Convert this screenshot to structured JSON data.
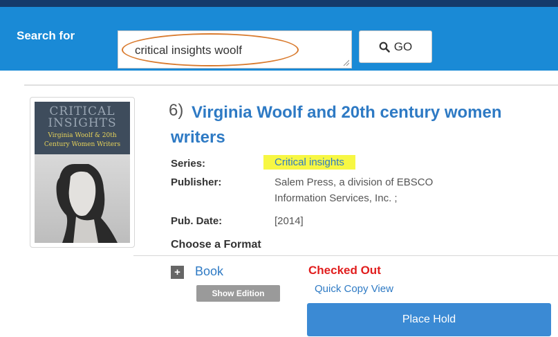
{
  "search": {
    "label": "Search for",
    "value": "critical insights woolf",
    "go_label": "GO"
  },
  "result": {
    "number": "6)",
    "title": "Virginia Woolf and 20th century women writers",
    "cover": {
      "title_line1": "CRITICAL",
      "title_line2": "INSIGHTS",
      "subtitle_line1": "Virginia Woolf & 20th",
      "subtitle_line2": "Century Women Writers"
    },
    "series_label": "Series:",
    "series_value": "Critical insights",
    "publisher_label": "Publisher:",
    "publisher_value_line1": "Salem Press, a division of EBSCO",
    "publisher_value_line2": "Information Services, Inc. ;",
    "pubdate_label": "Pub. Date:",
    "pubdate_value": "[2014]"
  },
  "format": {
    "heading": "Choose a Format",
    "expand_symbol": "+",
    "type": "Book",
    "show_edition": "Show Edition",
    "status": "Checked Out",
    "quick_copy": "Quick Copy View",
    "place_hold": "Place Hold"
  },
  "colors": {
    "header_blue": "#1a8ad6",
    "top_strip": "#153a6b",
    "link_blue": "#2e7ac4",
    "status_red": "#e11d1d",
    "highlight_yellow": "#f7f743",
    "callout_orange": "#d97a2d",
    "button_blue": "#3b8ad4"
  }
}
